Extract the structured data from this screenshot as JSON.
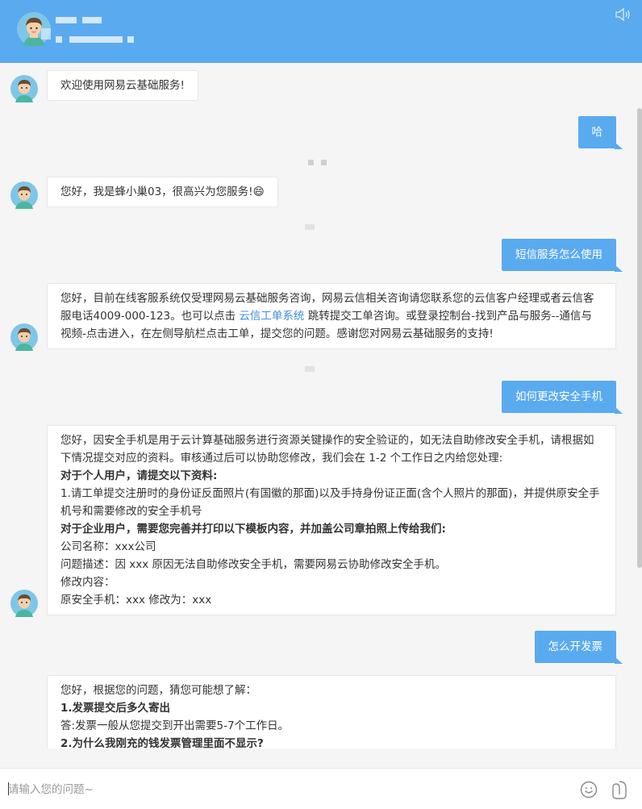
{
  "header": {
    "name_redacted": "",
    "subtitle_redacted": "",
    "avatar_icon": "user-avatar-icon",
    "sound_icon": "speaker-icon"
  },
  "messages": {
    "bot_welcome": "欢迎使用网易云基础服务!",
    "user_1": "哈",
    "bot_greeting": "您好，我是蜂小巢03，很高兴为您服务!😄",
    "user_2": "短信服务怎么使用",
    "bot_sms_part1": "您好，目前在线客服系统仅受理网易云基础服务咨询，网易云信相关咨询请您联系您的云信客户经理或者云信客服电话4009-000-123。也可以点击 ",
    "bot_sms_link": "云信工单系统",
    "bot_sms_part2": " 跳转提交工单咨询。或登录控制台-找到产品与服务--通信与视频-点击进入，在左侧导航栏点击工单，提交您的问题。感谢您对网易云基础服务的支持!",
    "user_3": "如何更改安全手机",
    "bot_phone_intro": "您好，因安全手机是用于云计算基础服务进行资源关键操作的安全验证的，如无法自助修改安全手机，请根据如下情况提交对应的资料。审核通过后可以协助您修改，我们会在 1-2 个工作日之内给您处理:",
    "bot_phone_personal_heading": "对于个人用户，请提交以下资料:",
    "bot_phone_personal_item": "1.请工单提交注册时的身份证反面照片(有国徽的那面)以及手持身份证正面(含个人照片的那面)，并提供原安全手机号和需要修改的安全手机号",
    "bot_phone_enterprise_heading": "对于企业用户，需要您完善并打印以下模板内容，并加盖公司章拍照上传给我们:",
    "bot_phone_company": "公司名称：xxx公司",
    "bot_phone_problem": "问题描述：因 xxx 原因无法自助修改安全手机，需要网易云协助修改安全手机。",
    "bot_phone_modify": "修改内容：",
    "bot_phone_change": "原安全手机：xxx 修改为：xxx",
    "user_4": "怎么开发票",
    "bot_invoice_intro": "您好，根据您的问题，猜您可能想了解：",
    "bot_invoice_q1": "1.发票提交后多久寄出",
    "bot_invoice_a1": "答:发票一般从您提交到开出需要5-7个工作日。",
    "bot_invoice_q2": "2.为什么我刚充的钱发票管理里面不显示?"
  },
  "input": {
    "placeholder": "请输入您的问题~",
    "emoji_icon": "smiley-icon",
    "attach_icon": "paperclip-icon"
  },
  "colors": {
    "accent": "#5aaaf0",
    "link": "#3d8fe0",
    "background": "#f5f5f5"
  }
}
